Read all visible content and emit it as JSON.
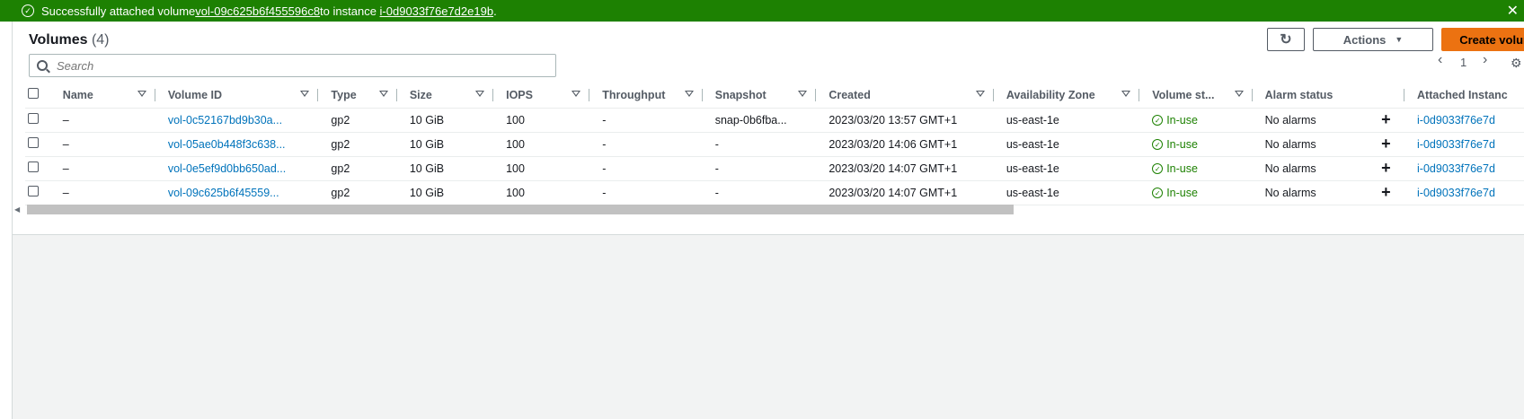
{
  "banner": {
    "prefix": "Successfully attached volume ",
    "volume_link": "vol-09c625b6f455596c8",
    "middle": " to instance ",
    "instance_link": "i-0d9033f76e7d2e19b",
    "suffix": ".",
    "close_glyph": "✕"
  },
  "header": {
    "title": "Volumes",
    "count": "(4)",
    "refresh_glyph": "↻",
    "actions_label": "Actions",
    "create_label": "Create volume"
  },
  "search": {
    "placeholder": "Search"
  },
  "pager": {
    "prev": "‹",
    "page": "1",
    "next": "›",
    "settings_glyph": "⚙"
  },
  "columns": [
    "Name",
    "Volume ID",
    "Type",
    "Size",
    "IOPS",
    "Throughput",
    "Snapshot",
    "Created",
    "Availability Zone",
    "Volume st...",
    "Alarm status",
    "",
    "Attached Instanc"
  ],
  "rows": [
    {
      "name": "–",
      "id": "vol-0c52167bd9b30a...",
      "type": "gp2",
      "size": "10 GiB",
      "iops": "100",
      "throughput": "-",
      "snapshot": "snap-0b6fba...",
      "created": "2023/03/20 13:57 GMT+1",
      "az": "us-east-1e",
      "state": "In-use",
      "alarm": "No alarms",
      "add": "+",
      "instance": "i-0d9033f76e7d"
    },
    {
      "name": "–",
      "id": "vol-05ae0b448f3c638...",
      "type": "gp2",
      "size": "10 GiB",
      "iops": "100",
      "throughput": "-",
      "snapshot": "-",
      "created": "2023/03/20 14:06 GMT+1",
      "az": "us-east-1e",
      "state": "In-use",
      "alarm": "No alarms",
      "add": "+",
      "instance": "i-0d9033f76e7d"
    },
    {
      "name": "–",
      "id": "vol-0e5ef9d0bb650ad...",
      "type": "gp2",
      "size": "10 GiB",
      "iops": "100",
      "throughput": "-",
      "snapshot": "-",
      "created": "2023/03/20 14:07 GMT+1",
      "az": "us-east-1e",
      "state": "In-use",
      "alarm": "No alarms",
      "add": "+",
      "instance": "i-0d9033f76e7d"
    },
    {
      "name": "–",
      "id": "vol-09c625b6f45559...",
      "type": "gp2",
      "size": "10 GiB",
      "iops": "100",
      "throughput": "-",
      "snapshot": "-",
      "created": "2023/03/20 14:07 GMT+1",
      "az": "us-east-1e",
      "state": "In-use",
      "alarm": "No alarms",
      "add": "+",
      "instance": "i-0d9033f76e7d"
    }
  ],
  "colors": {
    "banner": "#1d8102",
    "link": "#0073bb",
    "primary": "#ec7211",
    "status_ok": "#1d8102"
  }
}
